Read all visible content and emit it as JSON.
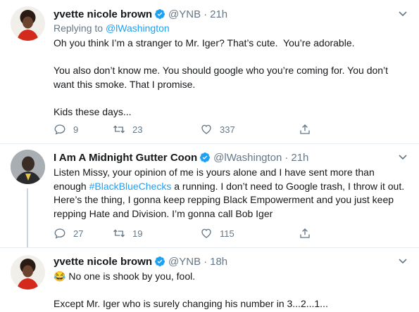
{
  "tweets": [
    {
      "name": "yvette nicole brown",
      "handle": "@YNB",
      "separator": "·",
      "time": "21h",
      "replying_prefix": "Replying to",
      "replying_to": "@lWashington",
      "text": "Oh you think I’m a stranger to Mr. Iger? That’s cute.  You’re adorable.\n\nYou also don’t know me. You should google who you’re coming for. You don’t want this smoke. That I promise.\n\nKids these days...",
      "replies": "9",
      "retweets": "23",
      "likes": "337"
    },
    {
      "name": "I Am A Midnight Gutter Coon",
      "handle": "@lWashington",
      "separator": "·",
      "time": "21h",
      "text_before": "Listen Missy, your opinion of me is yours alone and I have sent more than enough ",
      "hashtag": "#BlackBlueChecks",
      "text_after": " a running. I don’t need to Google trash, I throw it out. Here’s the thing, I gonna keep repping Black Empowerment and you just keep repping Hate and Division. I’m gonna call Bob Iger",
      "replies": "27",
      "retweets": "19",
      "likes": "115"
    },
    {
      "name": "yvette nicole brown",
      "handle": "@YNB",
      "separator": "·",
      "time": "18h",
      "emoji": "😂",
      "text": " No one is shook by you, fool.\n\nExcept Mr. Iger who is surely changing his number in 3...2...1..."
    }
  ],
  "colors": {
    "accent": "#1da1f2",
    "secondary_text": "#657786",
    "divider": "#e6ecf0"
  },
  "icons": [
    "verified-badge-icon",
    "chevron-down-icon",
    "reply-icon",
    "retweet-icon",
    "like-icon",
    "share-icon"
  ]
}
